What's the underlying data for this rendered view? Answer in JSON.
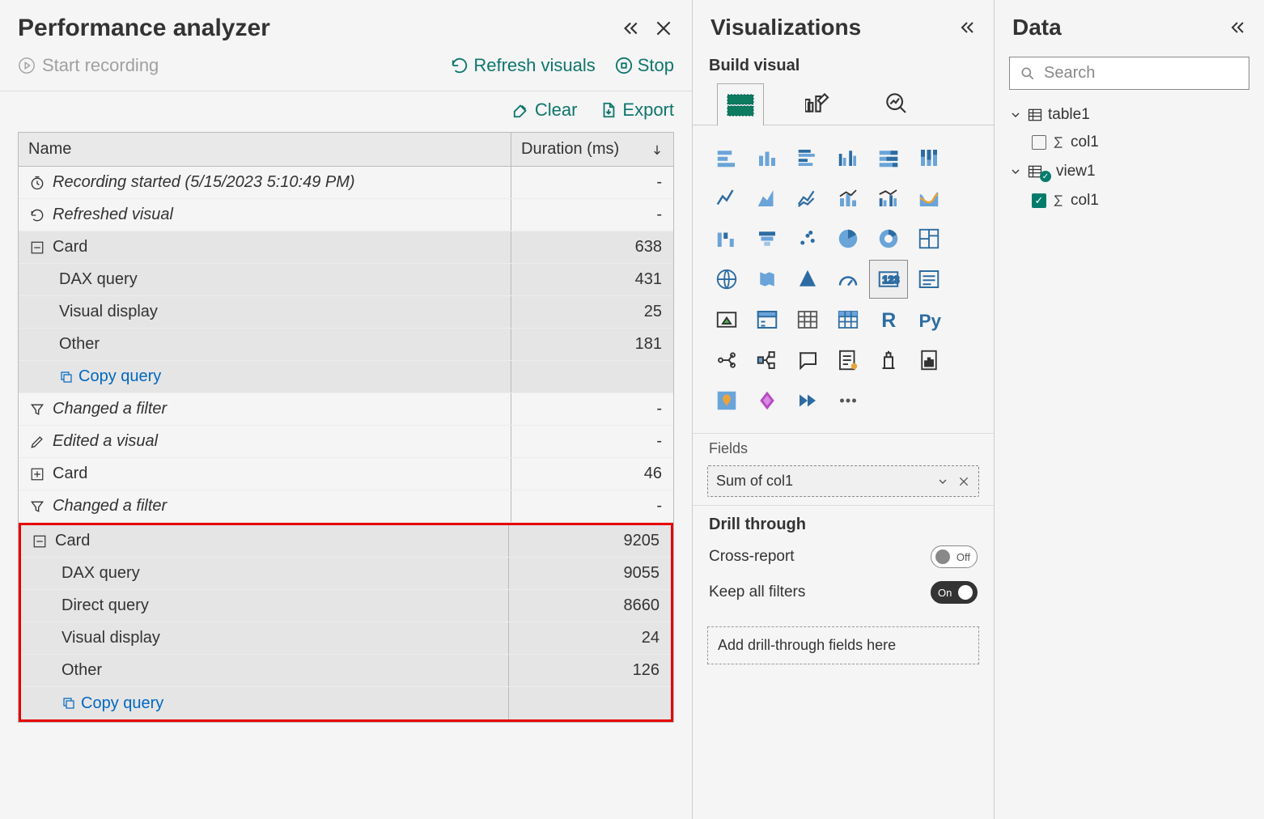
{
  "perf": {
    "title": "Performance analyzer",
    "start_recording": "Start recording",
    "refresh_visuals": "Refresh visuals",
    "stop": "Stop",
    "clear": "Clear",
    "export": "Export",
    "columns": {
      "name": "Name",
      "duration": "Duration (ms)"
    },
    "copy_query": "Copy query",
    "rows": [
      {
        "icon": "clock",
        "label": "Recording started (5/15/2023 5:10:49 PM)",
        "italic": true,
        "duration": "-"
      },
      {
        "icon": "refresh",
        "label": "Refreshed visual",
        "italic": true,
        "duration": "-"
      }
    ],
    "card1": {
      "label": "Card",
      "duration": "638",
      "children": [
        {
          "label": "DAX query",
          "duration": "431"
        },
        {
          "label": "Visual display",
          "duration": "25"
        },
        {
          "label": "Other",
          "duration": "181"
        }
      ]
    },
    "mid_rows": [
      {
        "icon": "filter",
        "label": "Changed a filter",
        "italic": true,
        "duration": "-"
      },
      {
        "icon": "pencil",
        "label": "Edited a visual",
        "italic": true,
        "duration": "-"
      },
      {
        "icon": "plus",
        "label": "Card",
        "italic": false,
        "duration": "46"
      },
      {
        "icon": "filter",
        "label": "Changed a filter",
        "italic": true,
        "duration": "-"
      }
    ],
    "card2": {
      "label": "Card",
      "duration": "9205",
      "children": [
        {
          "label": "DAX query",
          "duration": "9055"
        },
        {
          "label": "Direct query",
          "duration": "8660"
        },
        {
          "label": "Visual display",
          "duration": "24"
        },
        {
          "label": "Other",
          "duration": "126"
        }
      ]
    }
  },
  "viz": {
    "title": "Visualizations",
    "build_visual": "Build visual",
    "fields": "Fields",
    "field_value": "Sum of col1",
    "drill_through": "Drill through",
    "cross_report": "Cross-report",
    "cross_report_state": "Off",
    "keep_filters": "Keep all filters",
    "keep_filters_state": "On",
    "drop_hint": "Add drill-through fields here"
  },
  "data": {
    "title": "Data",
    "search_placeholder": "Search",
    "tables": [
      {
        "name": "table1",
        "cols": [
          {
            "name": "col1",
            "checked": false
          }
        ]
      },
      {
        "name": "view1",
        "badge": true,
        "cols": [
          {
            "name": "col1",
            "checked": true
          }
        ]
      }
    ]
  }
}
